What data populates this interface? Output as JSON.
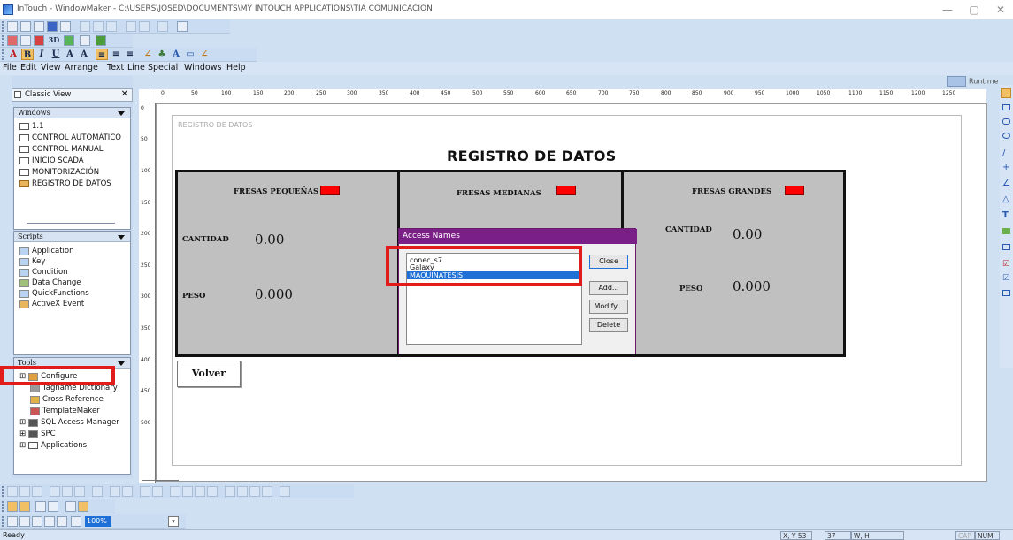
{
  "window": {
    "title": "InTouch - WindowMaker - C:\\USERS\\JOSED\\DOCUMENTS\\MY INTOUCH APPLICATIONS\\TIA COMUNICACION",
    "minimize": "—",
    "maximize": "▢",
    "close": "✕"
  },
  "menubar": {
    "file": "File",
    "edit": "Edit",
    "view": "View",
    "arrange": "Arrange",
    "text": "Text",
    "line": "Line",
    "special": "Special",
    "windows": "Windows",
    "help": "Help"
  },
  "runtime_label": "Runtime",
  "left": {
    "view_title": "Classic View",
    "windows_header": "Windows",
    "windows": [
      "1.1",
      "CONTROL AUTOMÁTICO",
      "CONTROL MANUAL",
      "INICIO SCADA",
      "MONITORIZACIÓN",
      "REGISTRO DE DATOS"
    ],
    "scripts_header": "Scripts",
    "scripts": [
      "Application",
      "Key",
      "Condition",
      "Data Change",
      "QuickFunctions",
      "ActiveX Event"
    ],
    "tools_header": "Tools",
    "tools": [
      "Configure",
      "Tagname Dictionary",
      "Cross Reference",
      "TemplateMaker",
      "SQL Access Manager",
      "SPC",
      "Applications"
    ]
  },
  "ruler": {
    "h_ticks": [
      "0",
      "50",
      "100",
      "150",
      "200",
      "250",
      "300",
      "350",
      "400",
      "450",
      "500",
      "550",
      "600",
      "650",
      "700",
      "750",
      "800",
      "850",
      "900",
      "950",
      "1000",
      "1050",
      "1100",
      "1150",
      "1200",
      "1250"
    ],
    "v_ticks": [
      "0",
      "50",
      "100",
      "150",
      "200",
      "250",
      "300",
      "350",
      "400",
      "450",
      "500"
    ]
  },
  "screen": {
    "window_title": "REGISTRO DE DATOS",
    "headline": "REGISTRO DE DATOS",
    "small": {
      "title": "FRESAS PEQUEÑAS",
      "cantidad_label": "CANTIDAD",
      "cantidad": "0.00",
      "peso_label": "PESO",
      "peso": "0.000"
    },
    "medium": {
      "title": "FRESAS MEDIANAS"
    },
    "large": {
      "title": "FRESAS GRANDES",
      "cantidad_label": "CANTIDAD",
      "cantidad": "0.00",
      "peso_label": "PESO",
      "peso": "0.000"
    },
    "back_button": "Volver"
  },
  "dialog": {
    "title": "Access Names",
    "items": [
      "conec_s7",
      "Galaxy",
      "MAQUINATESIS"
    ],
    "selected": "MAQUINATESIS",
    "close": "Close",
    "add": "Add...",
    "modify": "Modify...",
    "delete": "Delete"
  },
  "toolbar": {
    "zoom": "100%"
  },
  "status": {
    "ready": "Ready",
    "xy_label": "X, Y",
    "x": "53",
    "y": "37",
    "wh_label": "W, H",
    "cap": "CAP",
    "num": "NUM"
  }
}
